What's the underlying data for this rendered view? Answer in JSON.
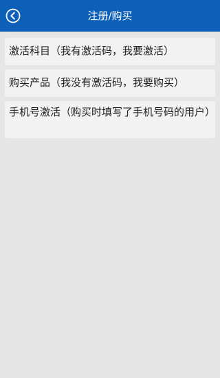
{
  "header": {
    "title": "注册/购买",
    "back_icon": "chevron-left-circle-icon"
  },
  "colors": {
    "header_bg": "#0d5fb8",
    "page_bg": "#e6e6e6",
    "item_bg": "#f2f2f2",
    "text": "#222222"
  },
  "menu": {
    "items": [
      {
        "label": "激活科目（我有激活码，我要激活）"
      },
      {
        "label": "购买产品（我没有激活码，我要购买）"
      },
      {
        "label": "手机号激活（购买时填写了手机号码的用户）"
      }
    ]
  }
}
